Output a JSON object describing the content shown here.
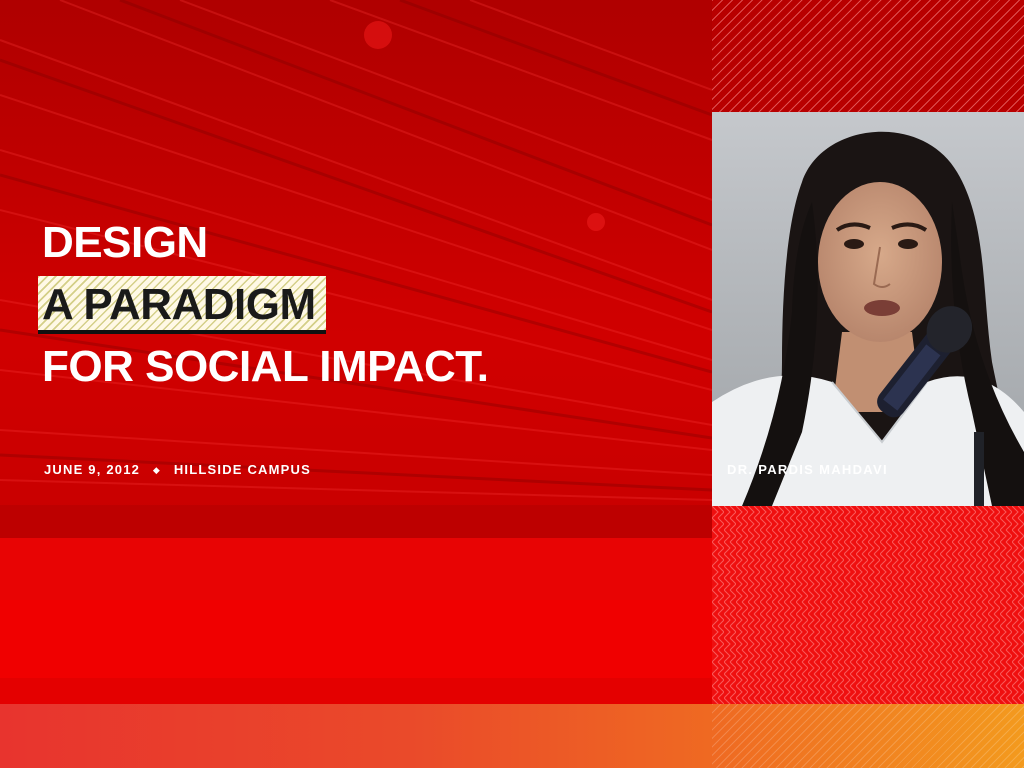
{
  "headline": {
    "line1": "DESIGN",
    "line2": "A PARADIGM",
    "line3": "FOR SOCIAL IMPACT."
  },
  "event": {
    "date": "JUNE 9, 2012",
    "separator": "◆",
    "location": "HILLSIDE CAMPUS"
  },
  "speaker": {
    "name": "DR. PARDIS MAHDAVI"
  },
  "colors": {
    "primary_red": "#d40000",
    "highlight_yellow": "#fff9e6",
    "text_white": "#ffffff",
    "text_dark": "#1a1a1a",
    "strip_orange": "#f39a1e"
  }
}
